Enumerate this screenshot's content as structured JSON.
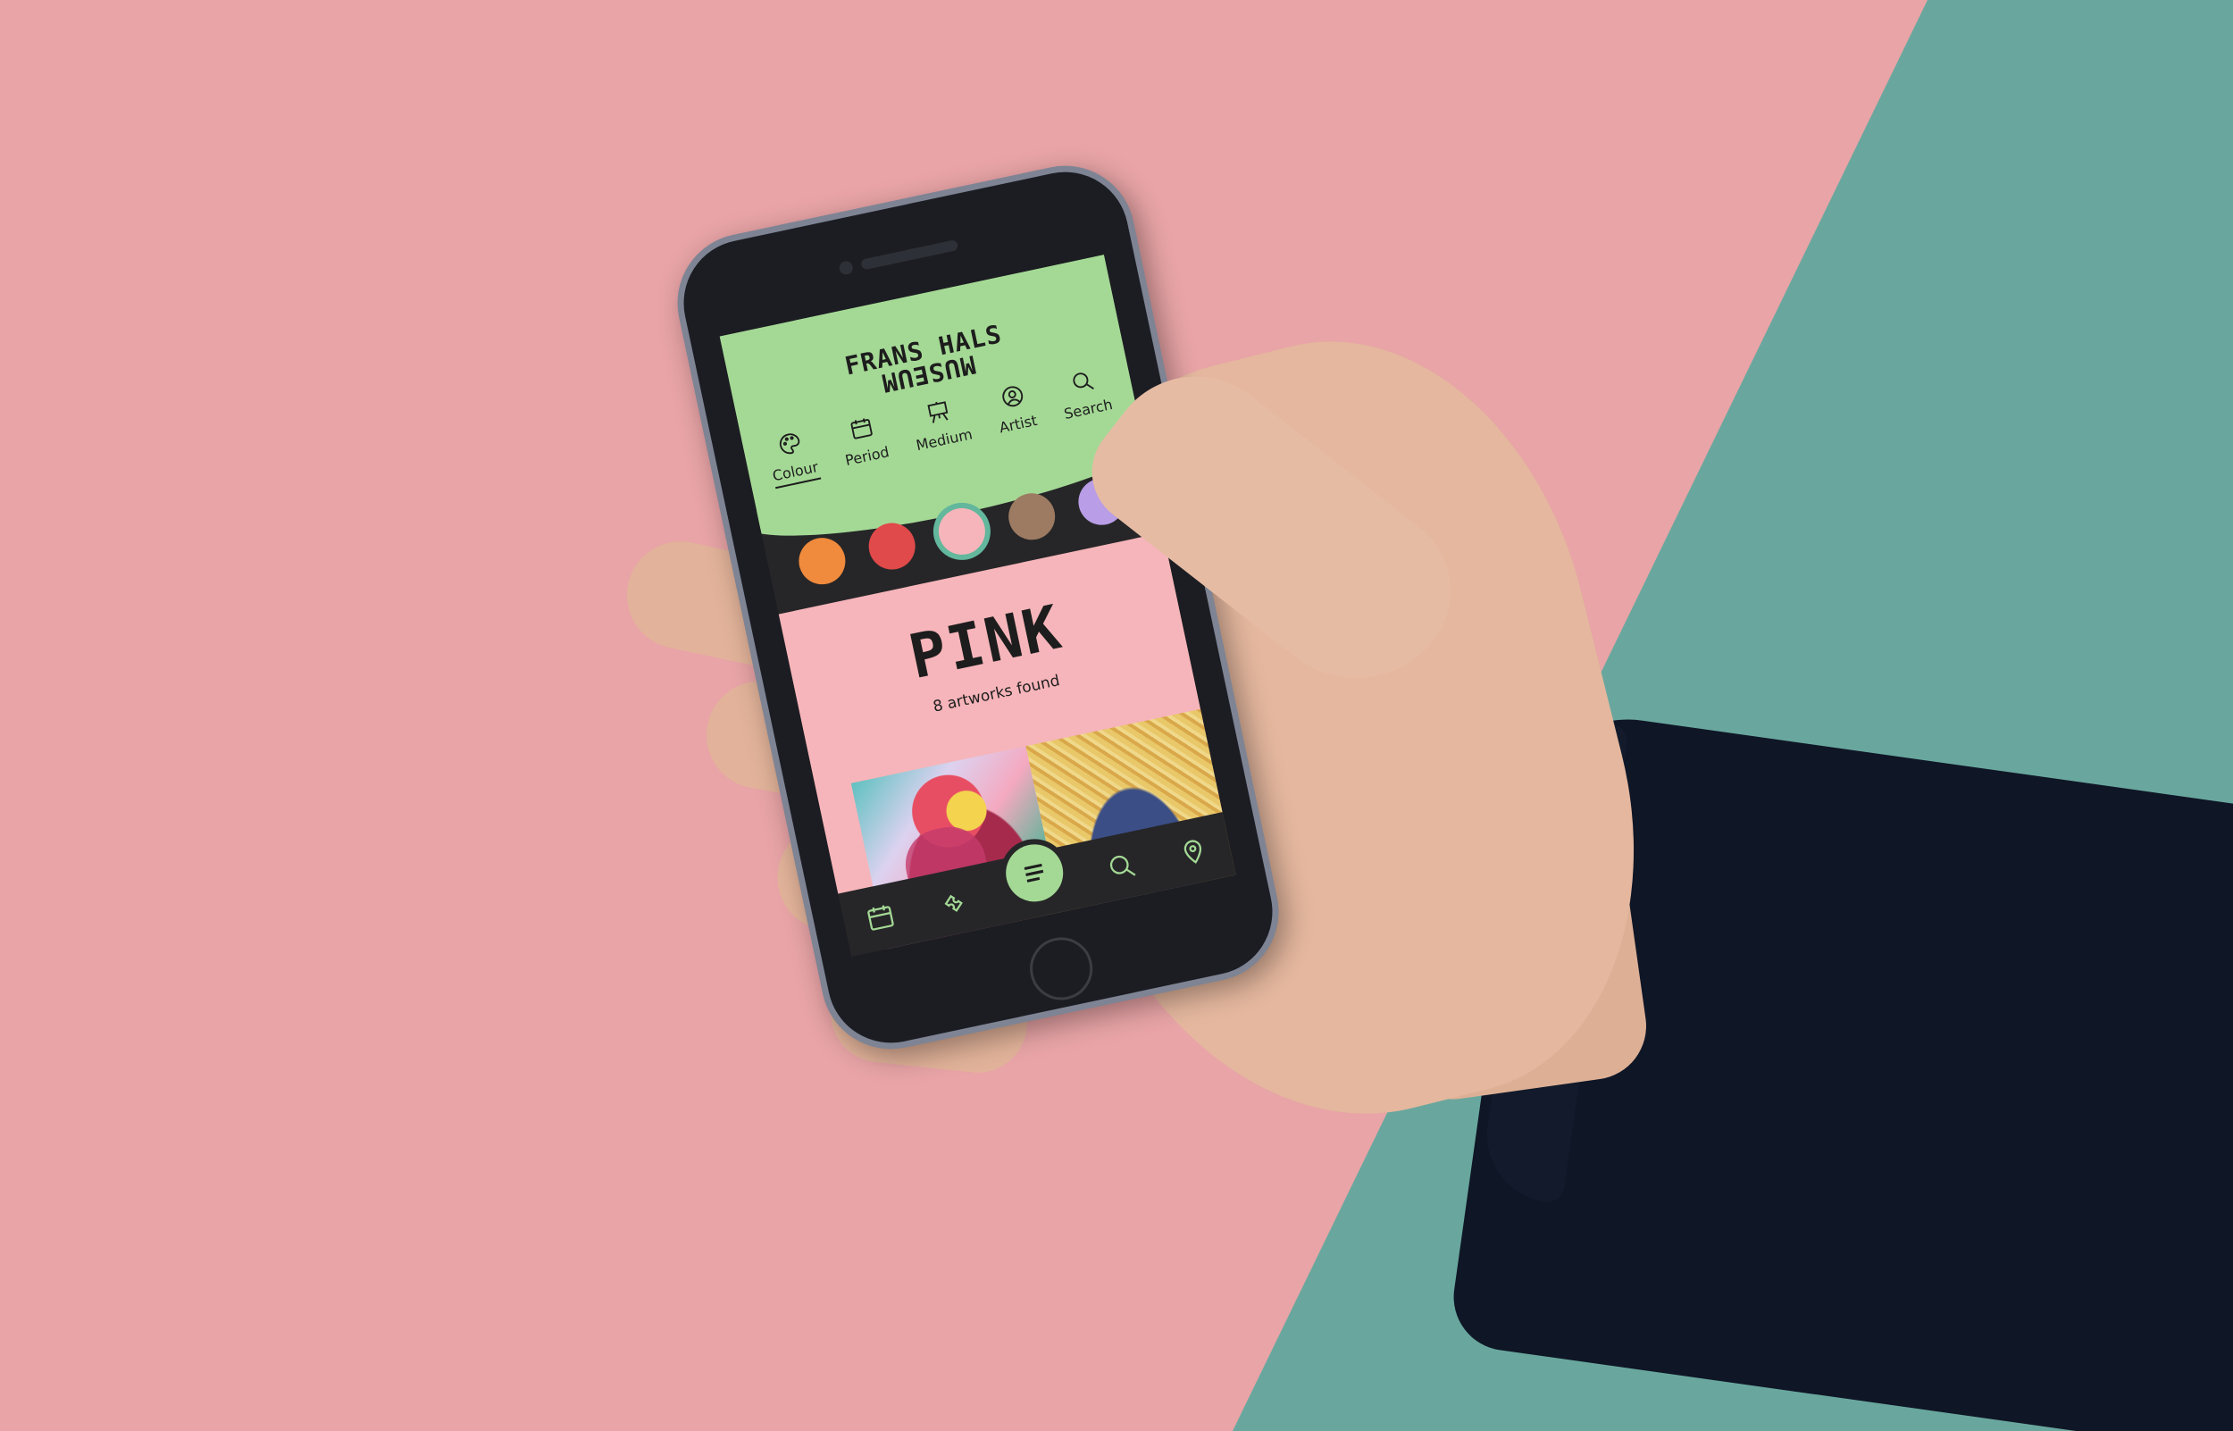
{
  "app": {
    "logo_top": "FRANS HALS",
    "logo_bottom": "MUSEUM"
  },
  "filter_tabs": [
    {
      "label": "Colour",
      "icon": "palette-icon",
      "active": true
    },
    {
      "label": "Period",
      "icon": "calendar-icon",
      "active": false
    },
    {
      "label": "Medium",
      "icon": "easel-icon",
      "active": false
    },
    {
      "label": "Artist",
      "icon": "user-icon",
      "active": false
    },
    {
      "label": "Search",
      "icon": "search-icon",
      "active": false
    }
  ],
  "swatches": [
    {
      "name": "orange",
      "color": "#f08a3c",
      "selected": false
    },
    {
      "name": "red",
      "color": "#e04a4a",
      "selected": false
    },
    {
      "name": "pink",
      "color": "#f6b5ba",
      "selected": true
    },
    {
      "name": "brown",
      "color": "#9c7b62",
      "selected": false
    },
    {
      "name": "purple",
      "color": "#b99de6",
      "selected": false
    }
  ],
  "results": {
    "title": "PINK",
    "count_text": "8 artworks found"
  },
  "bottom_nav": [
    {
      "icon": "calendar-icon"
    },
    {
      "icon": "ticket-icon"
    },
    {
      "icon": "menu-icon"
    },
    {
      "icon": "search-icon"
    },
    {
      "icon": "location-pin-icon"
    }
  ],
  "colors": {
    "accent_green": "#a4d995",
    "selected_ring": "#62b79c",
    "pink_background": "#e8a4a6",
    "teal_background": "#69a79e"
  }
}
